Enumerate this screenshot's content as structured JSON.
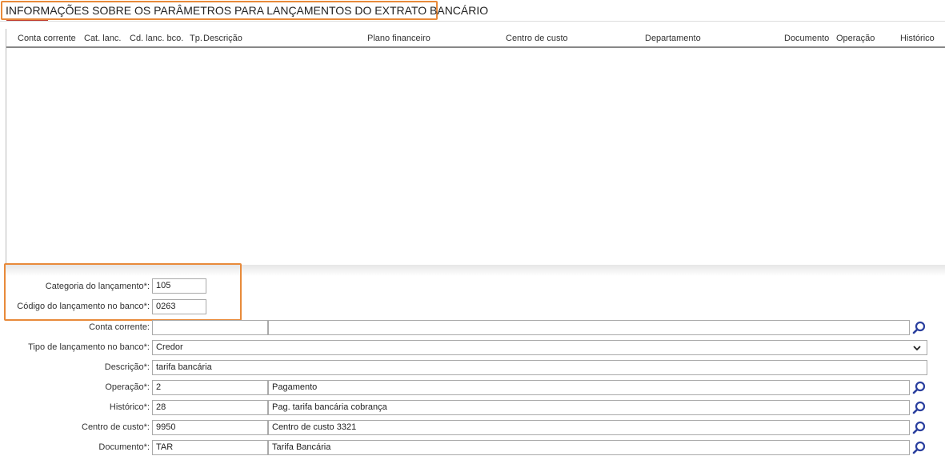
{
  "page": {
    "title": "INFORMAÇÕES SOBRE OS PARÂMETROS PARA LANÇAMENTOS DO EXTRATO BANCÁRIO"
  },
  "grid": {
    "columns": [
      "Conta corrente",
      "Cat. lanc.",
      "Cd. lanc. bco.",
      "Tp.",
      "Descrição",
      "Plano financeiro",
      "Centro de custo",
      "Departamento",
      "Documento",
      "Operação",
      "Histórico"
    ]
  },
  "form": {
    "categoria": {
      "label": "Categoria do lançamento*:",
      "value": "105"
    },
    "codigo": {
      "label": "Código do lançamento no banco*:",
      "value": "0263"
    },
    "conta_corrente": {
      "label": "Conta corrente:",
      "code": "",
      "name": ""
    },
    "tipo": {
      "label": "Tipo de lançamento no banco*:",
      "selected": "Credor"
    },
    "descricao": {
      "label": "Descrição*:",
      "value": "tarifa bancária"
    },
    "operacao": {
      "label": "Operação*:",
      "code": "2",
      "name": "Pagamento"
    },
    "historico": {
      "label": "Histórico*:",
      "code": "28",
      "name": "Pag. tarifa bancária cobrança"
    },
    "centro_custo": {
      "label": "Centro de custo*:",
      "code": "9950",
      "name": "Centro de custo 3321"
    },
    "documento": {
      "label": "Documento*:",
      "code": "TAR",
      "name": "Tarifa Bancária"
    }
  },
  "icons": {
    "search": "search-icon",
    "dropdown": "chevron-down-icon"
  },
  "colors": {
    "highlight": "#e88a3a",
    "tab_underline": "#c0392b",
    "search_icon": "#2a3f9e"
  }
}
